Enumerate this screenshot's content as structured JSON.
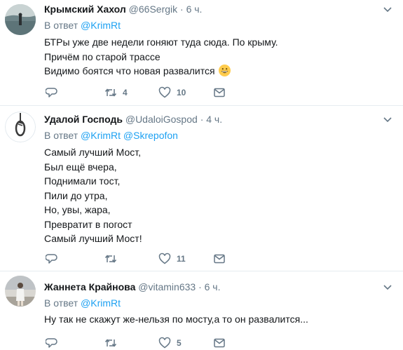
{
  "tweets": [
    {
      "name": "Крымский Хахол",
      "handle": "@66Sergik",
      "time": "· 6 ч.",
      "reply_prefix": "В ответ",
      "reply_to": [
        "@KrimRt"
      ],
      "lines": [
        "БТРы уже две недели гоняют туда сюда. По крыму.",
        "Причём по старой трассе",
        "Видимо боятся что новая развалится"
      ],
      "emoji": "grinning-face",
      "retweets": "4",
      "likes": "10"
    },
    {
      "name": "Удалой Господь",
      "handle": "@UdaloiGospod",
      "time": "· 4 ч.",
      "reply_prefix": "В ответ",
      "reply_to": [
        "@KrimRt",
        "@Skrepofon"
      ],
      "lines": [
        "Самый лучший Мост,",
        "Был ещё вчера,",
        "Поднимали тост,",
        "Пили до утра,",
        "Но, увы, жара,",
        "Превратит в погост",
        "Самый лучший Мост!"
      ],
      "retweets": "",
      "likes": "11"
    },
    {
      "name": "Жаннета Крайнова",
      "handle": "@vitamin633",
      "time": "· 6 ч.",
      "reply_prefix": "В ответ",
      "reply_to": [
        "@KrimRt"
      ],
      "lines": [
        "Ну так не скажут же-нельзя по мосту,а то он развалится..."
      ],
      "retweets": "",
      "likes": "5"
    }
  ],
  "colors": {
    "link": "#1da1f2",
    "muted": "#657786",
    "text": "#14171a",
    "divider": "#e6ecf0"
  }
}
